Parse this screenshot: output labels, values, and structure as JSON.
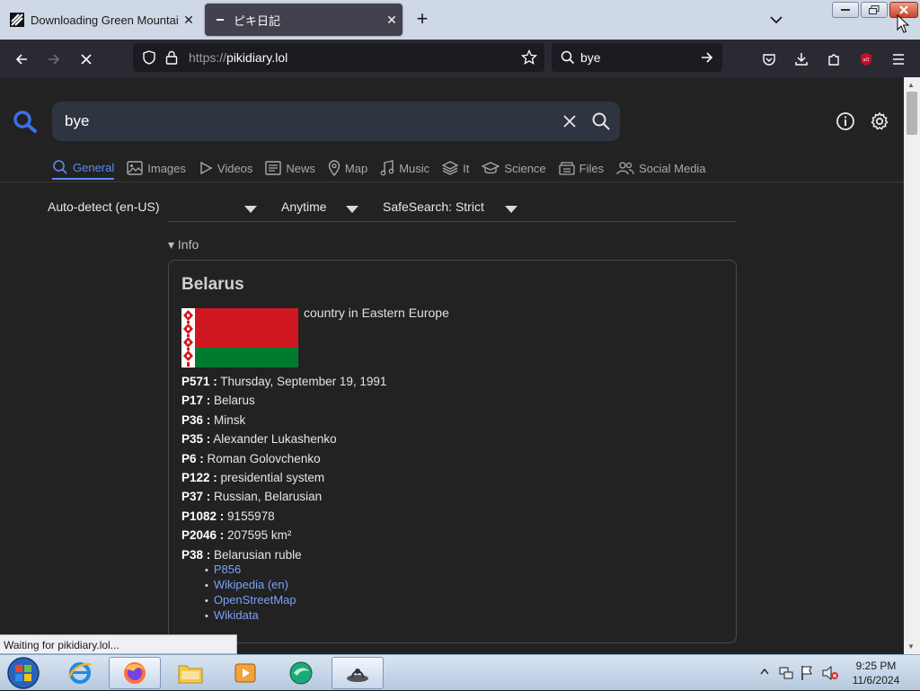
{
  "browser": {
    "tabs": [
      {
        "title": "Downloading Green Mountain",
        "active": false
      },
      {
        "title": "ピキ日記",
        "active": true
      }
    ],
    "url_scheme": "https://",
    "url_host": "pikidiary.lol",
    "search_query": "bye",
    "status_text": "Waiting for pikidiary.lol..."
  },
  "page": {
    "search_value": "bye",
    "categories": [
      {
        "label": "General",
        "icon": "search-icon"
      },
      {
        "label": "Images",
        "icon": "image-icon"
      },
      {
        "label": "Videos",
        "icon": "play-icon"
      },
      {
        "label": "News",
        "icon": "newspaper-icon"
      },
      {
        "label": "Map",
        "icon": "map-pin-icon"
      },
      {
        "label": "Music",
        "icon": "music-note-icon"
      },
      {
        "label": "It",
        "icon": "layers-icon"
      },
      {
        "label": "Science",
        "icon": "graduation-cap-icon"
      },
      {
        "label": "Files",
        "icon": "files-icon"
      },
      {
        "label": "Social Media",
        "icon": "people-icon"
      }
    ],
    "filters": {
      "language": "Auto-detect (en-US)",
      "time": "Anytime",
      "safesearch": "SafeSearch: Strict"
    },
    "info_toggle": "▾ Info",
    "infobox": {
      "title": "Belarus",
      "description": "country in Eastern Europe",
      "properties": [
        {
          "key": "P571 :",
          "value": " Thursday, September 19, 1991"
        },
        {
          "key": "P17 :",
          "value": " Belarus"
        },
        {
          "key": "P36 :",
          "value": " Minsk"
        },
        {
          "key": "P35 :",
          "value": " Alexander Lukashenko"
        },
        {
          "key": "P6 :",
          "value": " Roman Golovchenko"
        },
        {
          "key": "P122 :",
          "value": " presidential system"
        },
        {
          "key": "P37 :",
          "value": " Russian, Belarusian"
        },
        {
          "key": "P1082 :",
          "value": " 9155978"
        },
        {
          "key": "P2046 :",
          "value": " 207595 km²"
        },
        {
          "key": "P38 :",
          "value": " Belarusian ruble"
        }
      ],
      "links": [
        "P856",
        "Wikipedia (en)",
        "OpenStreetMap",
        "Wikidata"
      ]
    }
  },
  "taskbar": {
    "time": "9:25 PM",
    "date": "11/6/2024"
  },
  "colors": {
    "accent": "#5c8bf0",
    "link": "#7aa3f5",
    "flag_red": "#ce1720",
    "flag_green": "#007c30"
  }
}
